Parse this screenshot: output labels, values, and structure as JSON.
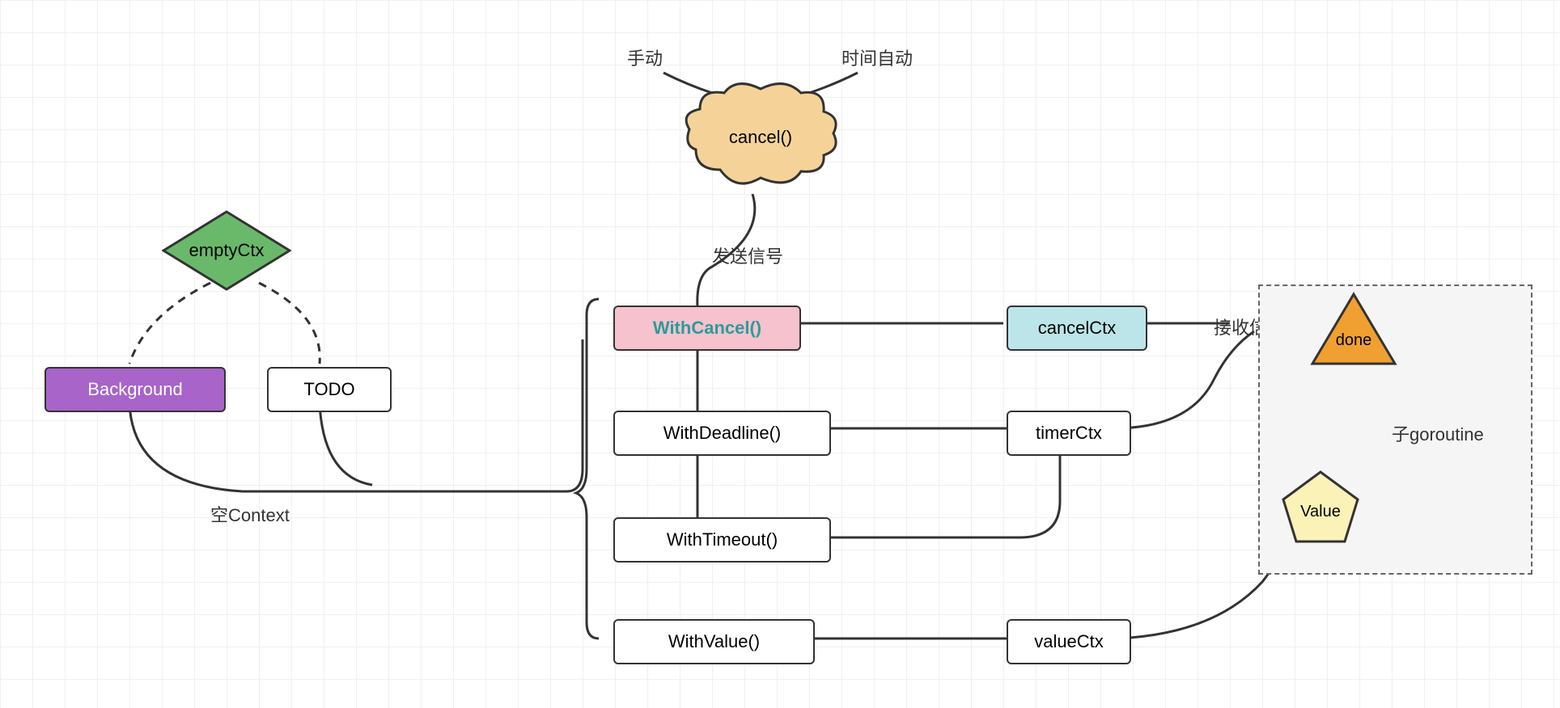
{
  "nodes": {
    "emptyCtx": "emptyCtx",
    "background": "Background",
    "todo": "TODO",
    "withCancel": "WithCancel()",
    "withDeadline": "WithDeadline()",
    "withTimeout": "WithTimeout()",
    "withValue": "WithValue()",
    "cancelCtx": "cancelCtx",
    "timerCtx": "timerCtx",
    "valueCtx": "valueCtx",
    "cancel": "cancel()",
    "done": "done",
    "value": "Value"
  },
  "labels": {
    "manual": "手动",
    "timeAuto": "时间自动",
    "sendSignal": "发送信号",
    "emptyContext": "空Context",
    "recvSignal": "接收信号",
    "childGoroutine": "子goroutine"
  },
  "colors": {
    "green": "#6ab96a",
    "purple": "#a864c9",
    "pink": "#f5c2cd",
    "blue": "#bce5e9",
    "orange": "#f0a030",
    "yellow": "#fbf2b8",
    "teal": "#2d9b9b"
  }
}
